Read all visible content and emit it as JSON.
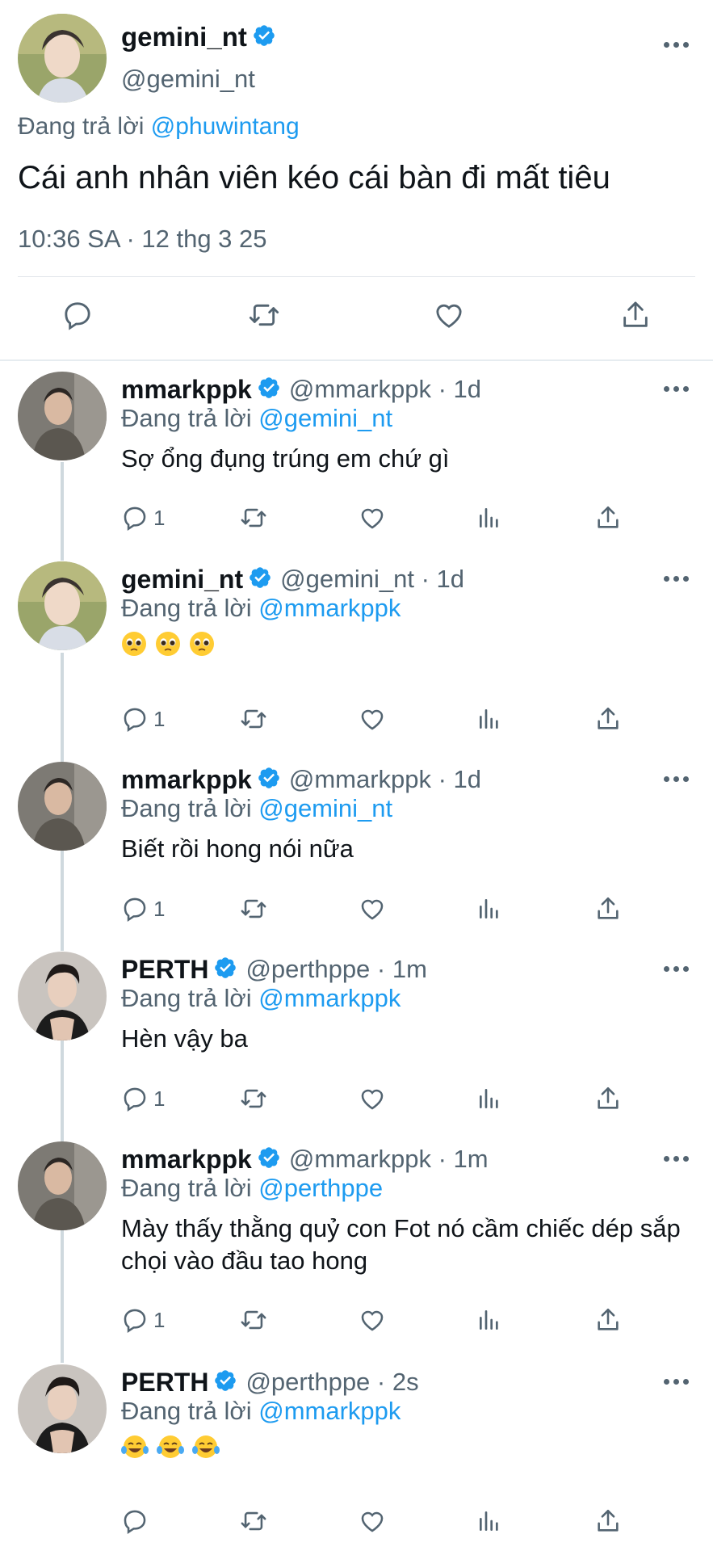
{
  "main_tweet": {
    "name": "gemini_nt",
    "handle": "@gemini_nt",
    "replying_prefix": "Đang trả lời ",
    "replying_to": "@phuwintang",
    "text": "Cái anh nhân viên kéo cái bàn đi mất tiêu",
    "timestamp": "10:36 SA · 12 thg 3 25"
  },
  "replies": [
    {
      "name": "mmarkppk",
      "handle_time": "@mmarkppk · 1d",
      "replying_prefix": "Đang trả lời ",
      "replying_to": "@gemini_nt",
      "text": "Sợ ổng đụng trúng em chứ gì",
      "reply_count": "1"
    },
    {
      "name": "gemini_nt",
      "handle_time": "@gemini_nt · 1d",
      "replying_prefix": "Đang trả lời ",
      "replying_to": "@mmarkppk",
      "emoji": [
        "pleading-face",
        "pleading-face",
        "pleading-face"
      ],
      "reply_count": "1"
    },
    {
      "name": "mmarkppk",
      "handle_time": "@mmarkppk · 1d",
      "replying_prefix": "Đang trả lời ",
      "replying_to": "@gemini_nt",
      "text": "Biết rồi hong nói nữa",
      "reply_count": "1"
    },
    {
      "name": "PERTH",
      "handle_time": "@perthppe · 1m",
      "replying_prefix": "Đang trả lời ",
      "replying_to": "@mmarkppk",
      "text": "Hèn vậy ba",
      "reply_count": "1"
    },
    {
      "name": "mmarkppk",
      "handle_time": "@mmarkppk · 1m",
      "replying_prefix": "Đang trả lời ",
      "replying_to": "@perthppe",
      "text": "Mày thấy thằng quỷ con Fot nó cầm chiếc dép sắp chọi vào đầu tao hong",
      "reply_count": "1"
    },
    {
      "name": "PERTH",
      "handle_time": "@perthppe · 2s",
      "replying_prefix": "Đang trả lời ",
      "replying_to": "@mmarkppk",
      "emoji": [
        "tears-of-joy",
        "tears-of-joy",
        "tears-of-joy"
      ],
      "reply_count": ""
    }
  ],
  "colors": {
    "link": "#1d9bf0",
    "secondary": "#536471",
    "verified": "#1d9bf0",
    "text": "#0f1419"
  }
}
